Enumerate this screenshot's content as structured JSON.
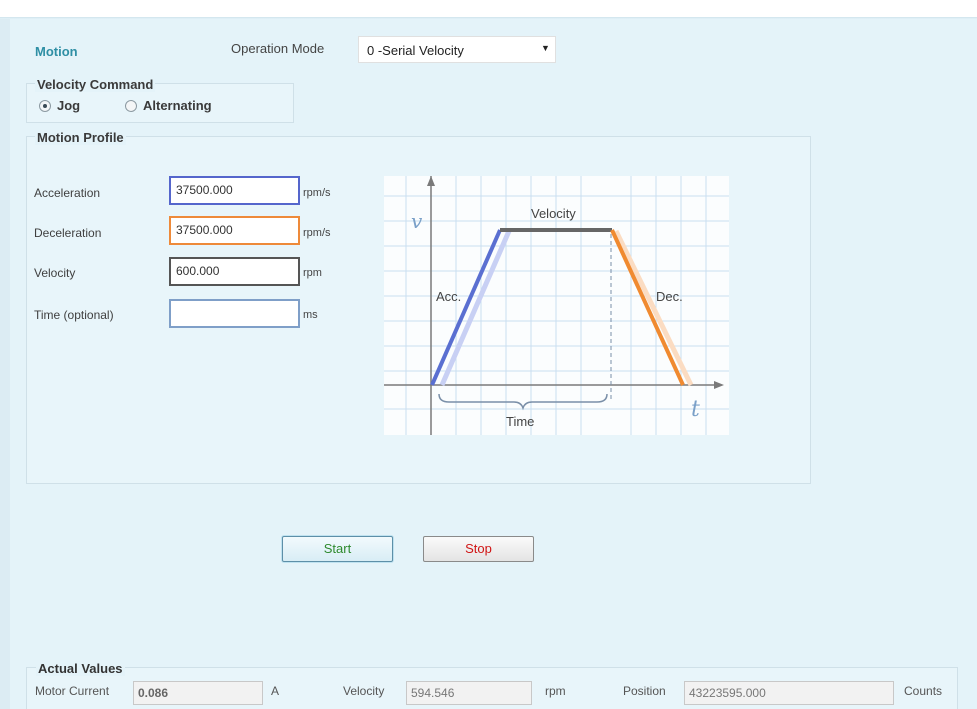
{
  "motion": {
    "title": "Motion",
    "operation_mode_label": "Operation Mode",
    "operation_mode_value": "0 -Serial Velocity"
  },
  "velocity_command": {
    "title": "Velocity Command",
    "options": [
      {
        "label": "Jog",
        "checked": true
      },
      {
        "label": "Alternating",
        "checked": false
      }
    ]
  },
  "motion_profile": {
    "title": "Motion Profile",
    "fields": [
      {
        "label": "Acceleration",
        "value": "37500.000",
        "unit": "rpm/s",
        "border_color": "#5566cc"
      },
      {
        "label": "Deceleration",
        "value": "37500.000",
        "unit": "rpm/s",
        "border_color": "#ee8a3a"
      },
      {
        "label": "Velocity",
        "value": "600.000",
        "unit": "rpm",
        "border_color": "#555555"
      },
      {
        "label": "Time (optional)",
        "value": "",
        "unit": "ms",
        "border_color": "#7f9fc8"
      }
    ],
    "diagram": {
      "v_label": "v",
      "t_label": "t",
      "velocity_label": "Velocity",
      "acc_label": "Acc.",
      "dec_label": "Dec.",
      "time_label": "Time",
      "colors": {
        "acc": "#5a6fd1",
        "dec": "#f08a30",
        "velocity": "#666666",
        "grid": "#c9dff0"
      }
    }
  },
  "buttons": {
    "start": "Start",
    "stop": "Stop"
  },
  "actual_values": {
    "title": "Actual Values",
    "motor_current_label": "Motor Current",
    "motor_current_value": "0.086",
    "motor_current_unit": "A",
    "velocity_label": "Velocity",
    "velocity_value": "594.546",
    "velocity_unit": "rpm",
    "position_label": "Position",
    "position_value": "43223595.000",
    "position_unit": "Counts"
  }
}
